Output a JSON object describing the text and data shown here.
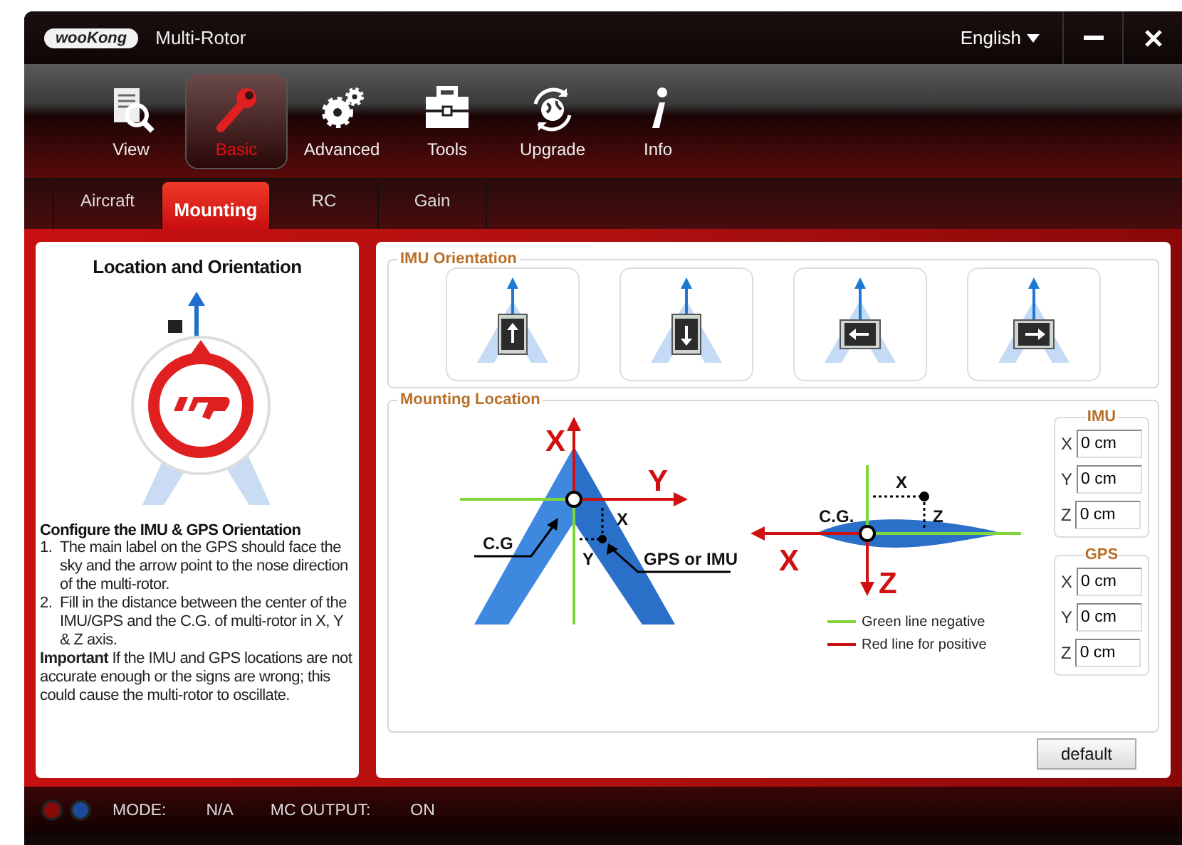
{
  "window": {
    "logo": "wooKong",
    "title": "Multi-Rotor",
    "language": "English"
  },
  "toolbar": [
    {
      "kind": "view",
      "label": "View",
      "selected": false
    },
    {
      "kind": "basic",
      "label": "Basic",
      "selected": true
    },
    {
      "kind": "advanced",
      "label": "Advanced",
      "selected": false
    },
    {
      "kind": "tools",
      "label": "Tools",
      "selected": false
    },
    {
      "kind": "upgrade",
      "label": "Upgrade",
      "selected": false
    },
    {
      "kind": "info",
      "label": "Info",
      "selected": false
    }
  ],
  "tabs": [
    {
      "label": "Aircraft",
      "selected": false
    },
    {
      "label": "Mounting",
      "selected": true
    },
    {
      "label": "RC",
      "selected": false
    },
    {
      "label": "Gain",
      "selected": false
    }
  ],
  "guide": {
    "title": "Location and Orientation",
    "heading": "Configure the IMU & GPS Orientation",
    "steps": [
      {
        "number": "1.",
        "text": "The main label on the GPS should face the sky and the arrow point to the nose direction of the multi-rotor."
      },
      {
        "number": "2.",
        "text": "Fill in the distance between the center of the IMU/GPS and the C.G. of multi-rotor in X, Y & Z axis."
      }
    ],
    "note": "**Important** If the IMU and GPS locations are not accurate enough or the signs are wrong; this could cause the multi-rotor to oscillate."
  },
  "imu_orientation": {
    "legend": "IMU Orientation",
    "options": [
      {
        "kind": "up"
      },
      {
        "kind": "down"
      },
      {
        "kind": "left"
      },
      {
        "kind": "right"
      }
    ]
  },
  "mounting_location": {
    "legend": "Mounting Location",
    "top_view": {
      "x_axis": "X",
      "y_axis": "Y",
      "cg": "C.G",
      "offset_x": "X",
      "offset_y": "Y",
      "device": "GPS or IMU"
    },
    "side_view": {
      "cg": "C.G.",
      "x_axis": "X",
      "z_axis": "Z",
      "offset_x": "X",
      "offset_z": "Z"
    },
    "legend_items": [
      {
        "kind": "negative",
        "text": "Green line negative"
      },
      {
        "kind": "positive",
        "text": "Red line for positive"
      }
    ],
    "groups": [
      {
        "title": "IMU",
        "fields": [
          {
            "axis": "X",
            "value": "0 cm"
          },
          {
            "axis": "Y",
            "value": "0 cm"
          },
          {
            "axis": "Z",
            "value": "0 cm"
          }
        ]
      },
      {
        "title": "GPS",
        "fields": [
          {
            "axis": "X",
            "value": "0 cm"
          },
          {
            "axis": "Y",
            "value": "0 cm"
          },
          {
            "axis": "Z",
            "value": "0 cm"
          }
        ]
      }
    ],
    "default_button": "default"
  },
  "status_bar": {
    "leds": [
      {
        "color": "#8a0a0a"
      },
      {
        "color": "#1a4a9a"
      }
    ],
    "mode_label": "MODE:",
    "mode_value": "N/A",
    "output_label": "MC OUTPUT:",
    "output_value": "ON"
  }
}
